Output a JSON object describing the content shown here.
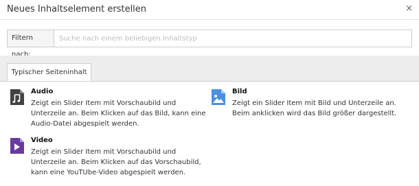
{
  "header": {
    "title": "Neues Inhaltselement erstellen",
    "close_glyph": "×"
  },
  "filter": {
    "label": "Filtern nach:",
    "placeholder": "Suche nach einem beliebigen Inhaltstyp",
    "value": ""
  },
  "tabs": [
    {
      "label": "Typischer Seiteninhalt",
      "active": true
    }
  ],
  "items": [
    {
      "icon": "audio-icon",
      "icon_color": "#424242",
      "name": "Audio",
      "description": "Zeigt ein Slider Item mit Vorschaubild und Unterzeile an. Beim Klicken auf das Bild, kann eine Audio-Datei abgespielt werden."
    },
    {
      "icon": "image-icon",
      "icon_color": "#4a90e2",
      "name": "Bild",
      "description": "Zeigt ein Slider Item mit Bild und Unterzeile an. Beim anklicken wird das Bild größer dargestellt."
    },
    {
      "icon": "video-icon",
      "icon_color": "#6a3b9e",
      "name": "Video",
      "description": "Zeigt ein Slider Item mit Vorschaubild und Unterzeile an. Beim Klicken auf das Vorschaubild, kann eine YouTUbe-Video abgespielt werden."
    }
  ]
}
